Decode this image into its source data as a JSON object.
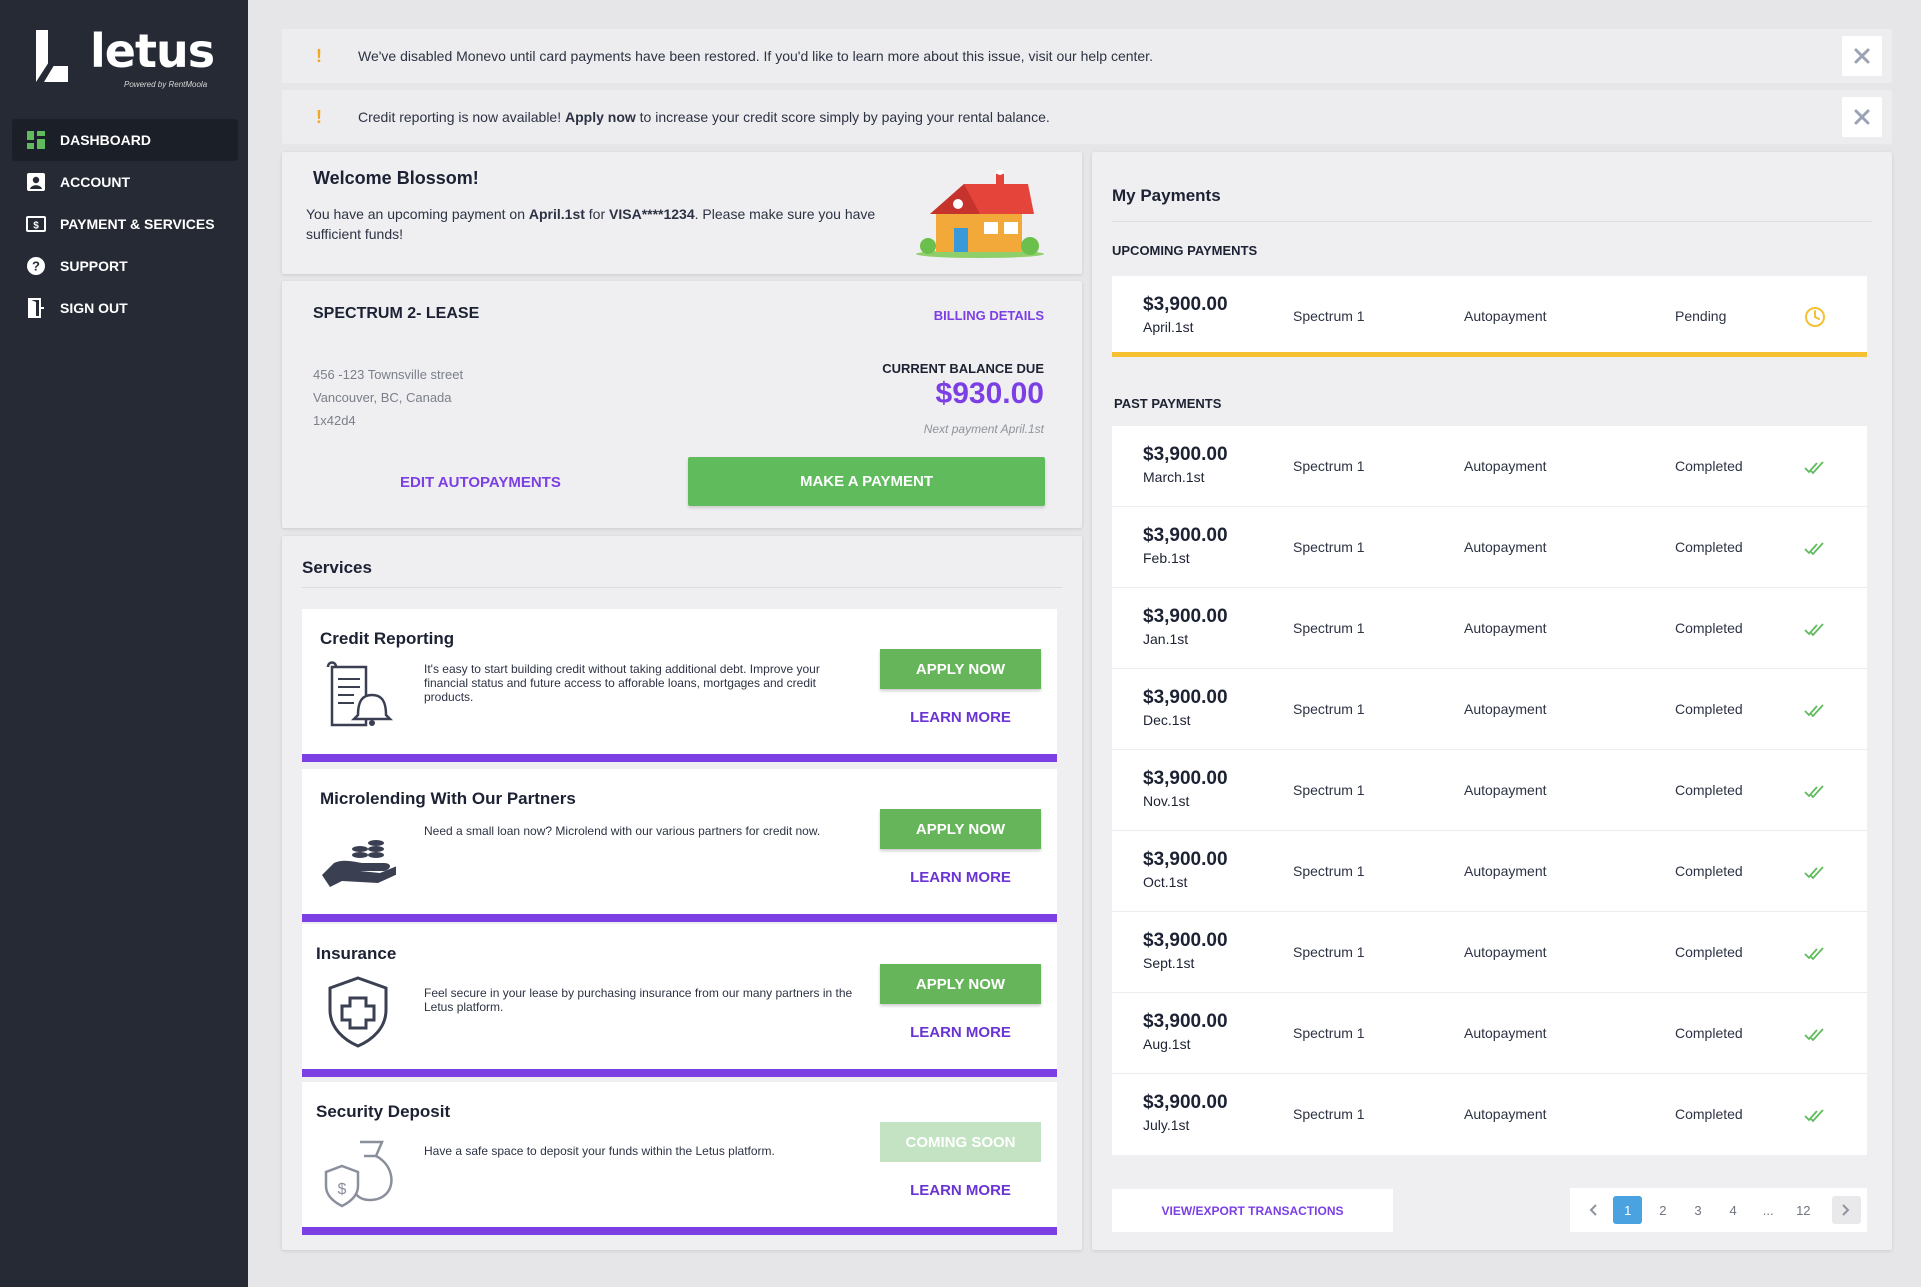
{
  "brand": {
    "name": "letus",
    "powered": "Powered by RentMoola"
  },
  "nav": [
    {
      "label": "DASHBOARD",
      "icon": "dashboard-icon",
      "active": true
    },
    {
      "label": "ACCOUNT",
      "icon": "account-icon"
    },
    {
      "label": "PAYMENT & SERVICES",
      "icon": "payment-icon"
    },
    {
      "label": "SUPPORT",
      "icon": "support-icon"
    },
    {
      "label": "SIGN OUT",
      "icon": "sign-out-icon"
    }
  ],
  "alerts": [
    {
      "pre": "We've disabled Monevo until card payments have been restored. If you'd like to learn more about this issue, visit our help center.",
      "link": "",
      "post": ""
    },
    {
      "pre": "Credit reporting is now available! ",
      "link": "Apply now",
      "post": " to increase your credit score simply by paying your rental balance."
    }
  ],
  "welcome": {
    "title": "Welcome Blossom!",
    "t1": "You have an upcoming payment on ",
    "date": "April.1st",
    "t2": " for ",
    "card": "VISA****1234",
    "t3": ". Please make sure you have sufficient funds!"
  },
  "lease": {
    "name": "SPECTRUM 2- LEASE",
    "billing": "BILLING DETAILS",
    "address": [
      "456 -123 Townsville street",
      "Vancouver, BC, Canada",
      "1x42d4"
    ],
    "due_label": "CURRENT BALANCE DUE",
    "due_amount": "$930.00",
    "next_payment": "Next payment April.1st",
    "edit": "EDIT AUTOPAYMENTS",
    "pay": "MAKE A PAYMENT"
  },
  "services": {
    "title": "Services",
    "items": [
      {
        "title": "Credit Reporting",
        "desc": "It's easy to start building credit without taking additional debt. Improve your financial status and future access to afforable loans, mortgages and credit products.",
        "action": "APPLY NOW",
        "learn": "LEARN MORE",
        "icon": "credit-report-icon"
      },
      {
        "title": "Microlending With Our Partners",
        "desc": "Need a small loan now? Microlend with our various partners for credit now.",
        "action": "APPLY NOW",
        "learn": "LEARN MORE",
        "icon": "hand-coins-icon"
      },
      {
        "title": "Insurance",
        "desc": "Feel secure in your lease by purchasing insurance from our many partners in the Letus platform.",
        "action": "APPLY NOW",
        "learn": "LEARN MORE",
        "icon": "shield-cross-icon"
      },
      {
        "title": "Security Deposit",
        "desc": "Have a safe space to deposit your funds within the Letus platform.",
        "action": "COMING SOON",
        "learn": "LEARN MORE",
        "icon": "money-bag-icon"
      }
    ]
  },
  "payments": {
    "title": "My Payments",
    "upcoming_label": "UPCOMING PAYMENTS",
    "past_label": "PAST PAYMENTS",
    "upcoming": {
      "amount": "$3,900.00",
      "date": "April.1st",
      "property": "Spectrum 1",
      "type": "Autopayment",
      "status": "Pending",
      "icon": "clock-icon"
    },
    "past": [
      {
        "amount": "$3,900.00",
        "date": "March.1st",
        "property": "Spectrum 1",
        "type": "Autopayment",
        "status": "Completed"
      },
      {
        "amount": "$3,900.00",
        "date": "Feb.1st",
        "property": "Spectrum 1",
        "type": "Autopayment",
        "status": "Completed"
      },
      {
        "amount": "$3,900.00",
        "date": "Jan.1st",
        "property": "Spectrum 1",
        "type": "Autopayment",
        "status": "Completed"
      },
      {
        "amount": "$3,900.00",
        "date": "Dec.1st",
        "property": "Spectrum 1",
        "type": "Autopayment",
        "status": "Completed"
      },
      {
        "amount": "$3,900.00",
        "date": "Nov.1st",
        "property": "Spectrum 1",
        "type": "Autopayment",
        "status": "Completed"
      },
      {
        "amount": "$3,900.00",
        "date": "Oct.1st",
        "property": "Spectrum 1",
        "type": "Autopayment",
        "status": "Completed"
      },
      {
        "amount": "$3,900.00",
        "date": "Sept.1st",
        "property": "Spectrum 1",
        "type": "Autopayment",
        "status": "Completed"
      },
      {
        "amount": "$3,900.00",
        "date": "Aug.1st",
        "property": "Spectrum 1",
        "type": "Autopayment",
        "status": "Completed"
      },
      {
        "amount": "$3,900.00",
        "date": "July.1st",
        "property": "Spectrum 1",
        "type": "Autopayment",
        "status": "Completed"
      }
    ],
    "export": "VIEW/EXPORT TRANSACTIONS",
    "pages": [
      "1",
      "2",
      "3",
      "4",
      "...",
      "12"
    ],
    "current_page": "1"
  },
  "colors": {
    "accent": "#7b3fe4",
    "green": "#5fbb5c",
    "warning": "#f5a623",
    "pending": "#f5c132",
    "sidebar": "#252a34"
  }
}
